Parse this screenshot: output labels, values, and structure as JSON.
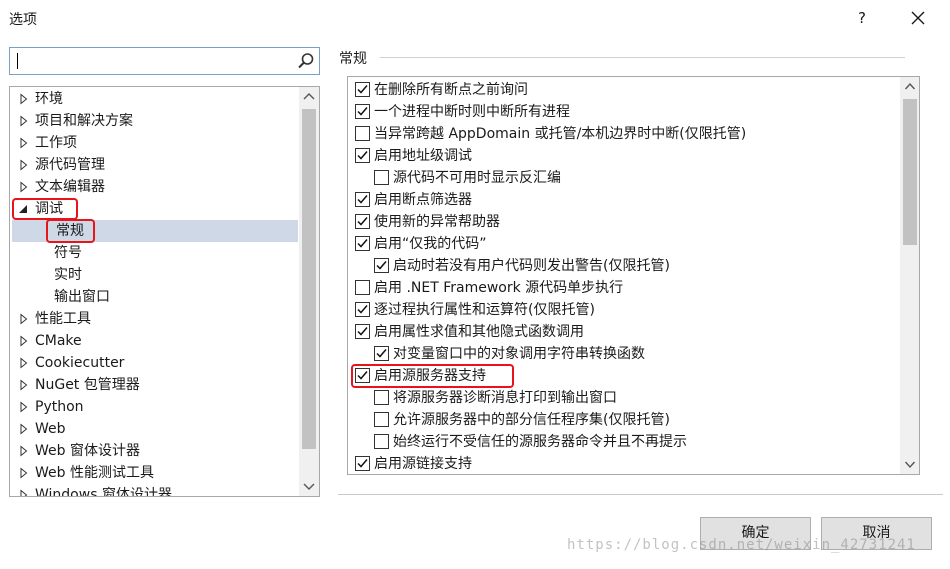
{
  "window": {
    "title": "选项"
  },
  "search": {
    "value": ""
  },
  "tree": {
    "items": [
      {
        "label": "环境",
        "arrow": "collapsed",
        "level": 0
      },
      {
        "label": "项目和解决方案",
        "arrow": "collapsed",
        "level": 0
      },
      {
        "label": "工作项",
        "arrow": "collapsed",
        "level": 0
      },
      {
        "label": "源代码管理",
        "arrow": "collapsed",
        "level": 0
      },
      {
        "label": "文本编辑器",
        "arrow": "collapsed",
        "level": 0
      },
      {
        "label": "调试",
        "arrow": "expanded",
        "level": 0,
        "highlighted": true
      },
      {
        "label": "常规",
        "arrow": "none",
        "level": 1,
        "selected": true,
        "highlighted": true
      },
      {
        "label": "符号",
        "arrow": "none",
        "level": 1
      },
      {
        "label": "实时",
        "arrow": "none",
        "level": 1
      },
      {
        "label": "输出窗口",
        "arrow": "none",
        "level": 1
      },
      {
        "label": "性能工具",
        "arrow": "collapsed",
        "level": 0
      },
      {
        "label": "CMake",
        "arrow": "collapsed",
        "level": 0
      },
      {
        "label": "Cookiecutter",
        "arrow": "collapsed",
        "level": 0
      },
      {
        "label": "NuGet 包管理器",
        "arrow": "collapsed",
        "level": 0
      },
      {
        "label": "Python",
        "arrow": "collapsed",
        "level": 0
      },
      {
        "label": "Web",
        "arrow": "collapsed",
        "level": 0
      },
      {
        "label": "Web 窗体设计器",
        "arrow": "collapsed",
        "level": 0
      },
      {
        "label": "Web 性能测试工具",
        "arrow": "collapsed",
        "level": 0
      },
      {
        "label": "Windows 窗体设计器",
        "arrow": "collapsed",
        "level": 0
      }
    ]
  },
  "section": {
    "title": "常规"
  },
  "options": [
    {
      "label": "在删除所有断点之前询问",
      "checked": true,
      "indent": 0
    },
    {
      "label": "一个进程中断时则中断所有进程",
      "checked": true,
      "indent": 0
    },
    {
      "label": "当异常跨越 AppDomain 或托管/本机边界时中断(仅限托管)",
      "checked": false,
      "indent": 0
    },
    {
      "label": "启用地址级调试",
      "checked": true,
      "indent": 0
    },
    {
      "label": "源代码不可用时显示反汇编",
      "checked": false,
      "indent": 1
    },
    {
      "label": "启用断点筛选器",
      "checked": true,
      "indent": 0
    },
    {
      "label": "使用新的异常帮助器",
      "checked": true,
      "indent": 0
    },
    {
      "label": "启用“仅我的代码”",
      "checked": true,
      "indent": 0
    },
    {
      "label": "启动时若没有用户代码则发出警告(仅限托管)",
      "checked": true,
      "indent": 1
    },
    {
      "label": "启用 .NET Framework 源代码单步执行",
      "checked": false,
      "indent": 0
    },
    {
      "label": "逐过程执行属性和运算符(仅限托管)",
      "checked": true,
      "indent": 0
    },
    {
      "label": "启用属性求值和其他隐式函数调用",
      "checked": true,
      "indent": 0
    },
    {
      "label": "对变量窗口中的对象调用字符串转换函数",
      "checked": true,
      "indent": 1
    },
    {
      "label": "启用源服务器支持",
      "checked": true,
      "indent": 0,
      "highlighted": true
    },
    {
      "label": "将源服务器诊断消息打印到输出窗口",
      "checked": false,
      "indent": 1
    },
    {
      "label": "允许源服务器中的部分信任程序集(仅限托管)",
      "checked": false,
      "indent": 1
    },
    {
      "label": "始终运行不受信任的源服务器命令并且不再提示",
      "checked": false,
      "indent": 1
    },
    {
      "label": "启用源链接支持",
      "checked": true,
      "indent": 0
    }
  ],
  "buttons": {
    "ok": "确定",
    "cancel": "取消"
  },
  "watermark": "https://blog.csdn.net/weixin_42731241",
  "colors": {
    "highlight": "#e8141b",
    "selection": "#cfd8e6"
  },
  "icons": {
    "help": "?",
    "close": "close-icon",
    "search": "search-icon"
  }
}
